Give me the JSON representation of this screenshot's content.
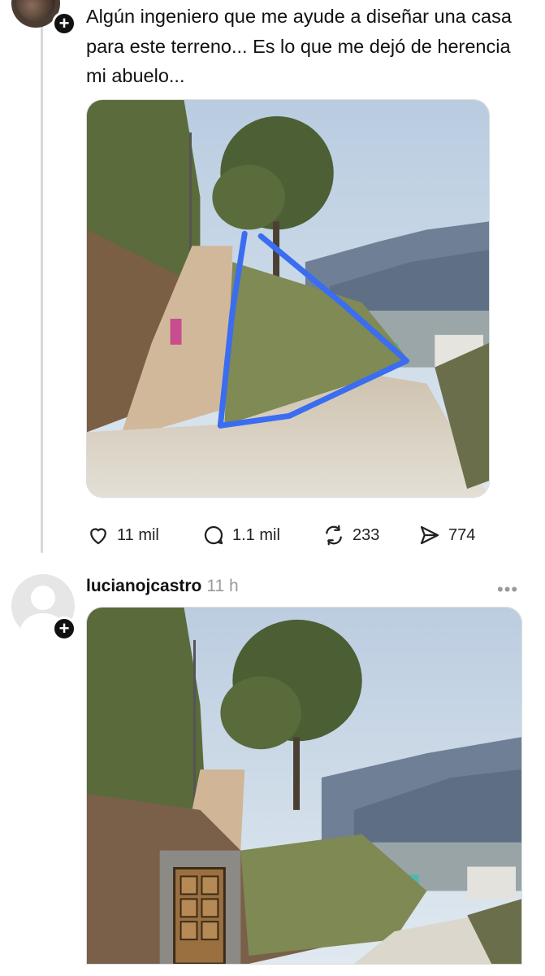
{
  "original_post": {
    "text": "Algún ingeniero que me ayude a diseñar una casa para este terreno... Es lo que me dejó de herencia mi abuelo...",
    "follow_symbol": "+"
  },
  "actions": {
    "likes": "11 mil",
    "comments": "1.1 mil",
    "reposts": "233",
    "shares": "774"
  },
  "reply": {
    "username": "lucianojcastro",
    "time": "11 h",
    "more": "•••",
    "follow_symbol": "+"
  },
  "colors": {
    "annotation_blue": "#3b6df0",
    "thread_line": "#d9d9d9",
    "muted": "#9a9a9a"
  }
}
